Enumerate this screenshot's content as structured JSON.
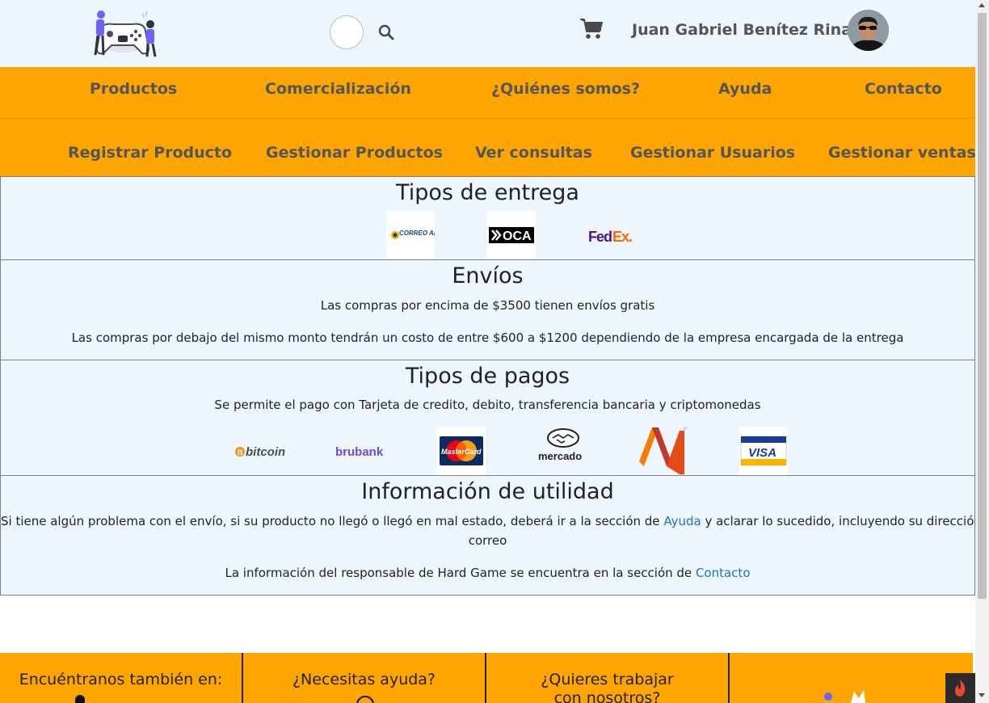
{
  "header": {
    "user_name": "Juan Gabriel Benítez Rinas",
    "icons": [
      "logo-icon",
      "search-icon",
      "cart-icon",
      "avatar"
    ]
  },
  "nav": {
    "row1": [
      "Productos",
      "Comercialización",
      "¿Quiénes somos?",
      "Ayuda",
      "Contacto"
    ],
    "row2": [
      "Registrar Producto",
      "Gestionar Productos",
      "Ver consultas",
      "Gestionar Usuarios",
      "Gestionar ventas"
    ]
  },
  "delivery": {
    "title": "Tipos de entrega",
    "logos": [
      "CORREO ARGENTINO",
      "OCA",
      "FedEx."
    ]
  },
  "shipping": {
    "title": "Envíos",
    "line1": "Las compras por encima de $3500 tienen envíos gratis",
    "line2": "Las compras por debajo del mismo monto tendrán un costo de entre $600 a $1200 dependiendo de la empresa encargada de la entrega"
  },
  "payments": {
    "title": "Tipos de pagos",
    "text": "Se permite el pago con Tarjeta de credito, debito, transferencia bancaria y criptomonedas",
    "logos": [
      "bitcoin",
      "brubank",
      "MasterCard",
      "mercado",
      "VISA"
    ]
  },
  "info": {
    "title": "Información de utilidad",
    "line1_pre": "Si tiene algún problema con el envío, si su producto no llegó o llegó en mal estado, deberá ir a la sección de",
    "line1_link": "Ayuda",
    "line1_post": "y aclarar lo sucedido, incluyendo su dirección de",
    "line1_end": "correo",
    "line2_pre": "La información del responsable de Hard Game se encuentra en la sección de",
    "line2_link": "Contacto"
  },
  "footer": {
    "col1": "Encuéntranos también en:",
    "col2": "¿Necesitas ayuda?",
    "col3": "¿Quieres trabajar con nosotros?"
  },
  "colors": {
    "nav_bg": "#ffa500",
    "content_bg": "#eef6fd",
    "link": "#1a73c9"
  }
}
